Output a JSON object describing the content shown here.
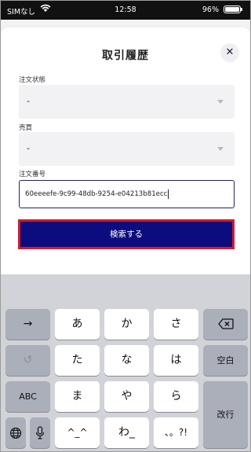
{
  "status_bar": {
    "carrier": "SIMなし",
    "time": "12:58",
    "battery_pct": "96%"
  },
  "sheet": {
    "title": "取引履歴",
    "close_glyph": "✕",
    "order_status": {
      "label": "注文状態",
      "value": "-"
    },
    "buy_sell": {
      "label": "売買",
      "value": "-"
    },
    "order_number": {
      "label": "注文番号",
      "value": "60eeeefe-9c99-48db-9254-e04213b81ecc"
    },
    "search_button": "検索する"
  },
  "keyboard": {
    "arrow": "→",
    "undo": "↺",
    "abc": "ABC",
    "globe": "🌐",
    "mic": "🎤",
    "delete": "⌫",
    "space": "空白",
    "return": "改行",
    "kana": [
      "あ",
      "か",
      "さ",
      "た",
      "な",
      "は",
      "ま",
      "や",
      "ら",
      "^_^",
      "わ_",
      "、。?!"
    ]
  },
  "colors": {
    "primary": "#0c0c7e",
    "highlight_border": "#d11a2a",
    "keyboard_bg": "#d1d3d9"
  }
}
